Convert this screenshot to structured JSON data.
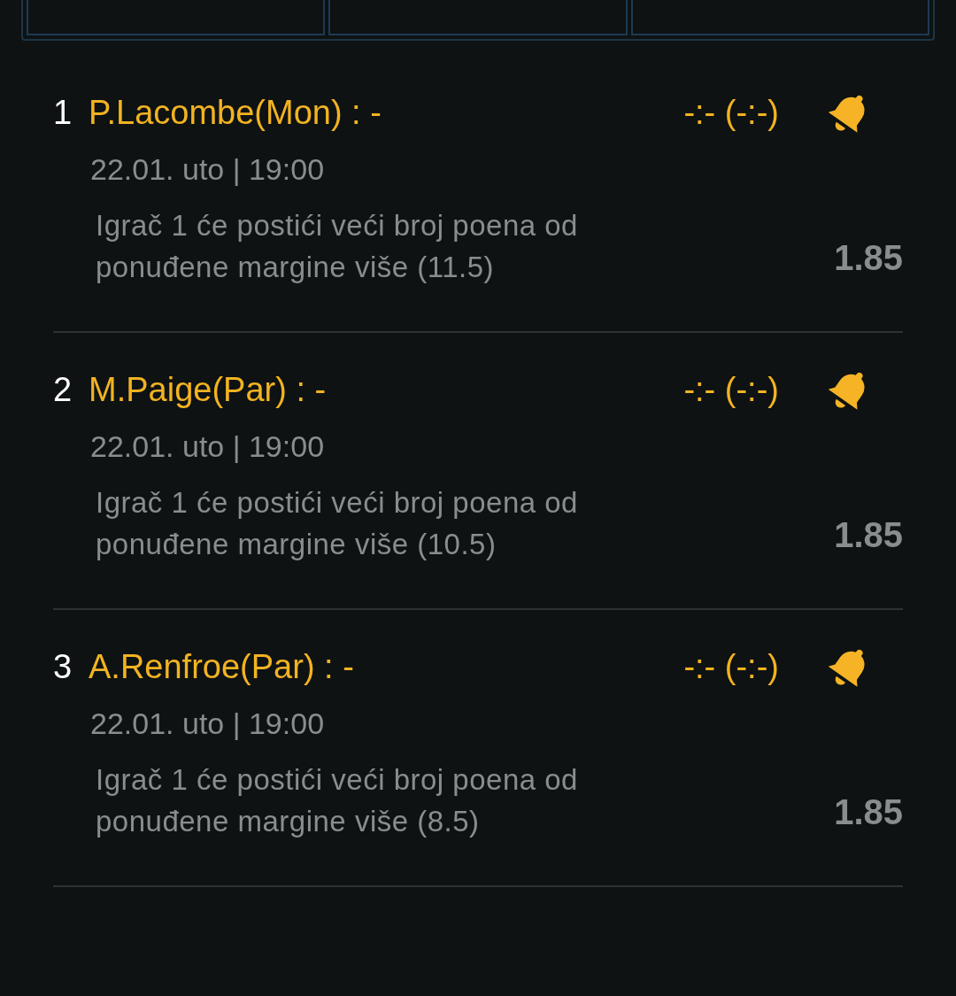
{
  "bets": [
    {
      "index": "1",
      "player": "P.Lacombe(Mon) : -",
      "score": "-:- (-:-)",
      "datetime": "22.01. uto | 19:00",
      "description": "Igrač 1 će postići veći broj poena od ponuđene margine više (11.5)",
      "odds": "1.85"
    },
    {
      "index": "2",
      "player": "M.Paige(Par) : -",
      "score": "-:- (-:-)",
      "datetime": "22.01. uto | 19:00",
      "description": "Igrač 1 će postići veći broj poena od ponuđene margine više (10.5)",
      "odds": "1.85"
    },
    {
      "index": "3",
      "player": "A.Renfroe(Par) : -",
      "score": "-:- (-:-)",
      "datetime": "22.01. uto | 19:00",
      "description": "Igrač 1 će postići veći broj poena od ponuđene margine više (8.5)",
      "odds": "1.85"
    }
  ]
}
